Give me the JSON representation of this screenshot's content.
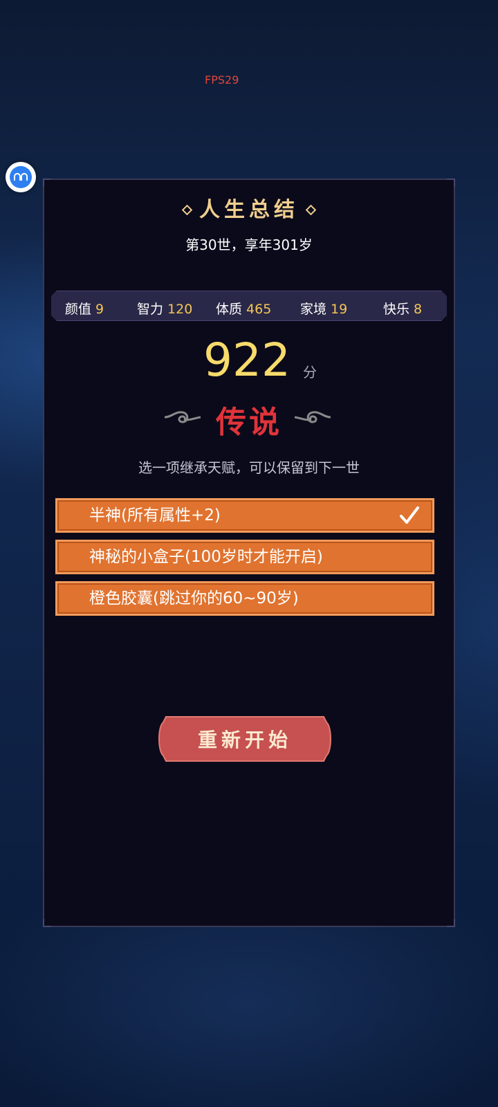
{
  "debug": {
    "fps_label": "FPS29"
  },
  "summary": {
    "title": "人生总结",
    "lifespan": "第30世，享年301岁"
  },
  "stats": [
    {
      "name": "颜值",
      "value": "9"
    },
    {
      "name": "智力",
      "value": "120"
    },
    {
      "name": "体质",
      "value": "465"
    },
    {
      "name": "家境",
      "value": "19"
    },
    {
      "name": "快乐",
      "value": "8"
    }
  ],
  "score": {
    "value": "922",
    "unit": "分"
  },
  "rank": {
    "label": "传说"
  },
  "inherit": {
    "tip": "选一项继承天赋，可以保留到下一世",
    "talents": [
      {
        "label": "半神(所有属性+2)",
        "selected": true
      },
      {
        "label": "神秘的小盒子(100岁时才能开启)",
        "selected": false
      },
      {
        "label": "橙色胶囊(跳过你的60~90岁)",
        "selected": false
      }
    ]
  },
  "actions": {
    "restart_label": "重新开始"
  },
  "colors": {
    "panel_bg": "#0b0a1b",
    "title_gold": "#f0cf8e",
    "stat_value": "#f3c655",
    "score": "#f7db6b",
    "rank_red": "#e0343a",
    "talent_orange": "#e0732f",
    "restart_red": "#c65150"
  }
}
